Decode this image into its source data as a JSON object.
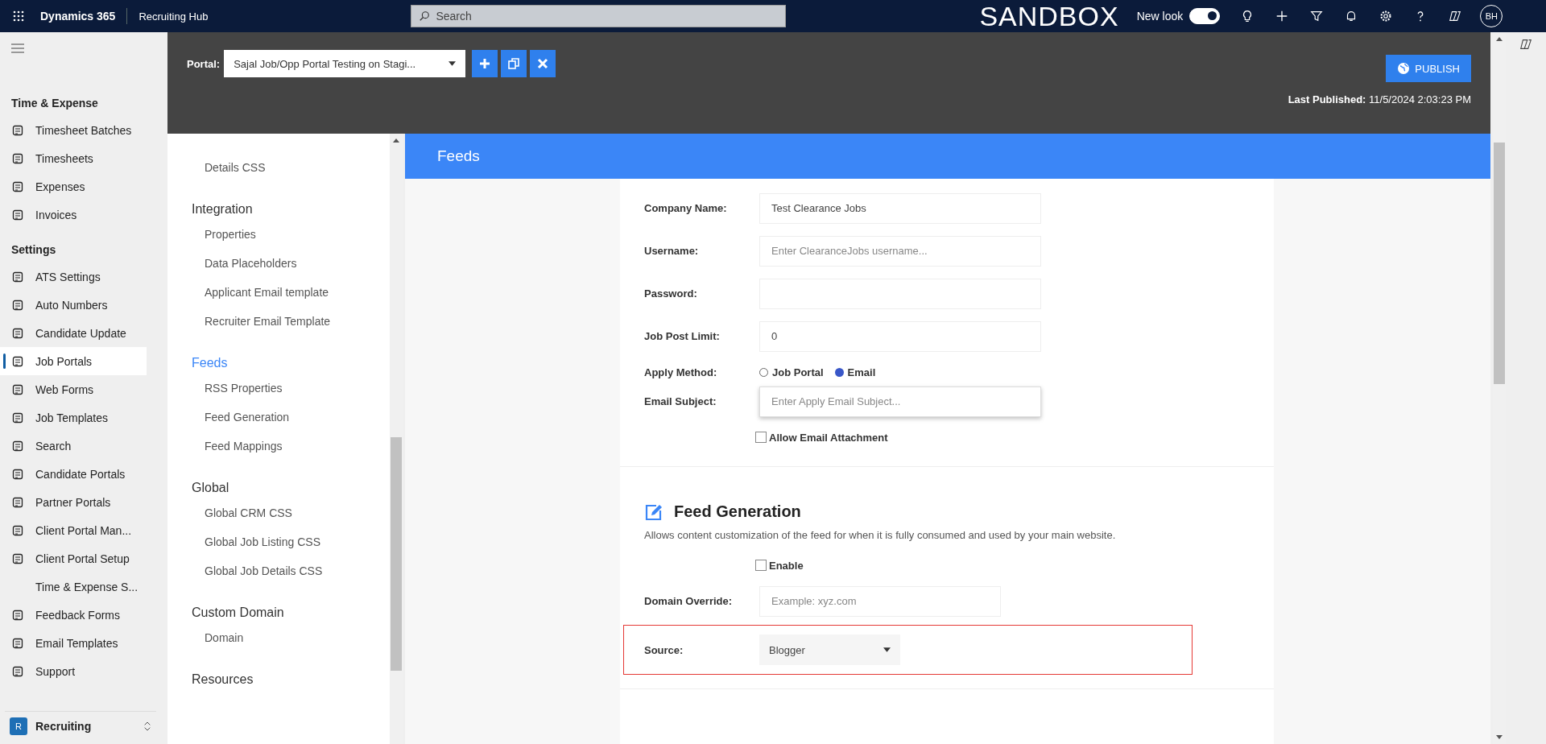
{
  "top_bar": {
    "app_name": "Dynamics 365",
    "area": "Recruiting Hub",
    "search": {
      "placeholder": "Search"
    },
    "environment": "SANDBOX",
    "new_look": {
      "label": "New look",
      "on": true
    },
    "avatar": "BH"
  },
  "nav": {
    "sections": [
      {
        "title": "Time & Expense",
        "items": [
          {
            "label": "Timesheet Batches",
            "selected": false
          },
          {
            "label": "Timesheets",
            "selected": false
          },
          {
            "label": "Expenses",
            "selected": false
          },
          {
            "label": "Invoices",
            "selected": false
          }
        ]
      },
      {
        "title": "Settings",
        "items": [
          {
            "label": "ATS Settings",
            "selected": false
          },
          {
            "label": "Auto Numbers",
            "selected": false
          },
          {
            "label": "Candidate Update",
            "selected": false
          },
          {
            "label": "Job Portals",
            "selected": true
          },
          {
            "label": "Web Forms",
            "selected": false
          },
          {
            "label": "Job Templates",
            "selected": false
          },
          {
            "label": "Search",
            "selected": false
          },
          {
            "label": "Candidate Portals",
            "selected": false
          },
          {
            "label": "Partner Portals",
            "selected": false
          },
          {
            "label": "Client Portal Man...",
            "selected": false
          },
          {
            "label": "Client Portal Setup",
            "selected": false
          },
          {
            "label": "Time & Expense S...",
            "selected": false
          },
          {
            "label": "Feedback Forms",
            "selected": false
          },
          {
            "label": "Email Templates",
            "selected": false
          },
          {
            "label": "Support",
            "selected": false
          }
        ]
      }
    ],
    "area_switcher": {
      "badge": "R",
      "label": "Recruiting"
    }
  },
  "portal_bar": {
    "label": "Portal:",
    "selected_portal": "Sajal Job/Opp Portal Testing on Stagi...",
    "publish": "PUBLISH",
    "last_published_label": "Last Published:",
    "last_published": "11/5/2024 2:03:23 PM"
  },
  "sidebar": {
    "top_items": [
      "Details CSS"
    ],
    "groups": [
      {
        "title": "Integration",
        "items": [
          "Properties",
          "Data Placeholders",
          "Applicant Email template",
          "Recruiter Email Template"
        ],
        "selected": false
      },
      {
        "title": "Feeds",
        "items": [
          "RSS Properties",
          "Feed Generation",
          "Feed Mappings"
        ],
        "selected": true
      },
      {
        "title": "Global",
        "items": [
          "Global CRM CSS",
          "Global Job Listing CSS",
          "Global Job Details CSS"
        ],
        "selected": false
      },
      {
        "title": "Custom Domain",
        "items": [
          "Domain"
        ],
        "selected": false
      },
      {
        "title": "Resources",
        "selected": false
      }
    ]
  },
  "section_header": "Feeds",
  "form": {
    "fields": [
      {
        "kind": "text",
        "label": "Company Name:",
        "value": "Test Clearance Jobs"
      },
      {
        "kind": "text",
        "label": "Username:",
        "placeholder": "Enter ClearanceJobs username..."
      },
      {
        "kind": "text",
        "label": "Password:"
      },
      {
        "kind": "text",
        "label": "Job Post Limit:",
        "value": "0"
      },
      {
        "kind": "radio",
        "label": "Apply Method:",
        "options": [
          {
            "label": "Job Portal",
            "selected": false
          },
          {
            "label": "Email",
            "selected": true
          }
        ]
      },
      {
        "kind": "text",
        "label": "Email Subject:",
        "placeholder": "Enter Apply Email Subject...",
        "focused": true
      },
      {
        "kind": "checkbox",
        "label": "Allow Email Attachment",
        "checked": false
      }
    ]
  },
  "feed_generation": {
    "title": "Feed Generation",
    "description": "Allows content customization of the feed for when it is fully consumed and used by your main website.",
    "fields": [
      {
        "kind": "checkbox",
        "label": "Enable",
        "checked": false
      },
      {
        "kind": "text",
        "label": "Domain Override:",
        "placeholder": "Example: xyz.com"
      },
      {
        "kind": "select",
        "label": "Source:",
        "value": "Blogger",
        "highlighted": true
      }
    ]
  }
}
